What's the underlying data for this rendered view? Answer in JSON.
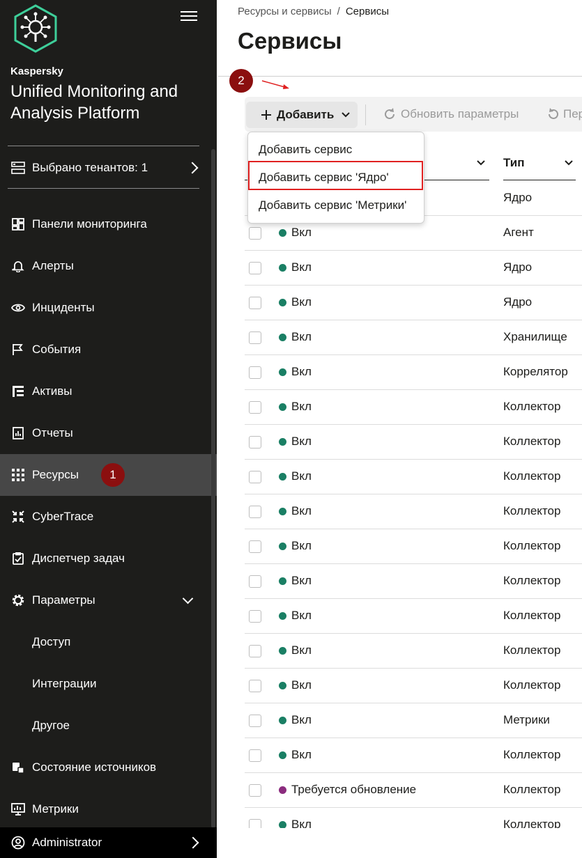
{
  "colors": {
    "sidebar_bg": "#1d1d1b",
    "active_bg": "#474747",
    "accent_badge": "#8b0f0f",
    "status_on": "#1a7f64",
    "status_update": "#8b2c7e",
    "highlight": "#e02020"
  },
  "sidebar": {
    "brand": "Kaspersky",
    "product": "Unified Monitoring and Analysis Platform",
    "tenants_label": "Выбрано тенантов: 1",
    "items": [
      {
        "label": "Панели мониторинга",
        "icon": "dashboard-icon"
      },
      {
        "label": "Алерты",
        "icon": "bell-icon"
      },
      {
        "label": "Инциденты",
        "icon": "eye-icon"
      },
      {
        "label": "События",
        "icon": "flag-icon"
      },
      {
        "label": "Активы",
        "icon": "tree-icon"
      },
      {
        "label": "Отчеты",
        "icon": "report-icon"
      },
      {
        "label": "Ресурсы",
        "icon": "grid-icon"
      },
      {
        "label": "CyberTrace",
        "icon": "arrows-in-icon"
      },
      {
        "label": "Диспетчер задач",
        "icon": "clipboard-icon"
      },
      {
        "label": "Параметры",
        "icon": "gear-icon"
      }
    ],
    "sub_items": [
      "Доступ",
      "Интеграции",
      "Другое"
    ],
    "bottom_items": [
      {
        "label": "Состояние источников",
        "icon": "source-icon"
      },
      {
        "label": "Метрики",
        "icon": "monitor-icon"
      }
    ],
    "user": "Administrator",
    "step_badge": "1"
  },
  "main": {
    "breadcrumb": {
      "parent": "Ресурсы и сервисы",
      "sep": "/",
      "current": "Сервисы"
    },
    "title": "Сервисы",
    "step_badge": "2",
    "toolbar": {
      "add": "Добавить",
      "refresh": "Обновить параметры",
      "restart": "Пер"
    },
    "dropdown": [
      "Добавить сервис",
      "Добавить сервис 'Ядро'",
      "Добавить сервис 'Метрики'"
    ],
    "columns": {
      "type": "Тип"
    },
    "rows": [
      {
        "status": "",
        "type": "Ядро"
      },
      {
        "status": "Вкл",
        "type": "Агент"
      },
      {
        "status": "Вкл",
        "type": "Ядро"
      },
      {
        "status": "Вкл",
        "type": "Ядро"
      },
      {
        "status": "Вкл",
        "type": "Хранилище"
      },
      {
        "status": "Вкл",
        "type": "Коррелятор"
      },
      {
        "status": "Вкл",
        "type": "Коллектор"
      },
      {
        "status": "Вкл",
        "type": "Коллектор"
      },
      {
        "status": "Вкл",
        "type": "Коллектор"
      },
      {
        "status": "Вкл",
        "type": "Коллектор"
      },
      {
        "status": "Вкл",
        "type": "Коллектор"
      },
      {
        "status": "Вкл",
        "type": "Коллектор"
      },
      {
        "status": "Вкл",
        "type": "Коллектор"
      },
      {
        "status": "Вкл",
        "type": "Коллектор"
      },
      {
        "status": "Вкл",
        "type": "Коллектор"
      },
      {
        "status": "Вкл",
        "type": "Метрики"
      },
      {
        "status": "Вкл",
        "type": "Коллектор"
      },
      {
        "status": "Требуется обновление",
        "type": "Коллектор"
      },
      {
        "status": "Вкл",
        "type": "Коллектор"
      }
    ]
  }
}
